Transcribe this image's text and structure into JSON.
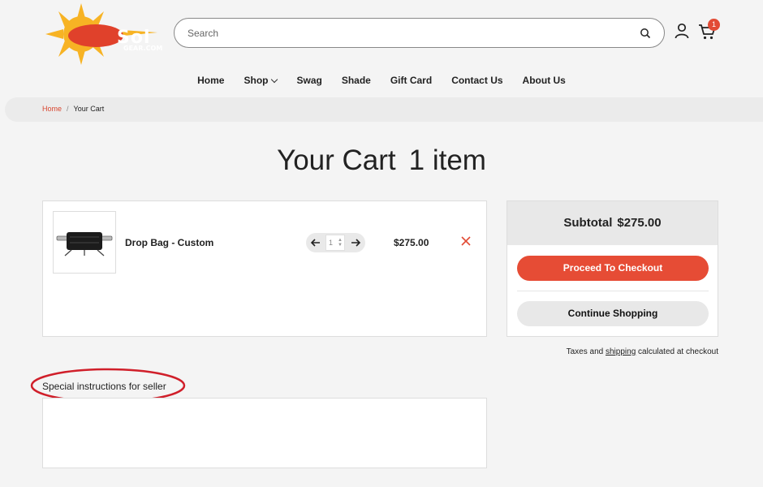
{
  "header": {
    "logo": {
      "text": "Sol",
      "sub": "GEAR.COM"
    },
    "search": {
      "placeholder": "Search"
    },
    "cart_count": "1"
  },
  "nav": {
    "items": [
      {
        "label": "Home"
      },
      {
        "label": "Shop",
        "has_dropdown": true
      },
      {
        "label": "Swag"
      },
      {
        "label": "Shade"
      },
      {
        "label": "Gift Card"
      },
      {
        "label": "Contact Us"
      },
      {
        "label": "About Us"
      }
    ]
  },
  "breadcrumb": {
    "home": "Home",
    "separator": "/",
    "current": "Your Cart"
  },
  "page": {
    "title": "Your Cart",
    "count": "1 item"
  },
  "cart": {
    "items": [
      {
        "name": "Drop Bag - Custom",
        "quantity": "1",
        "price": "$275.00"
      }
    ]
  },
  "summary": {
    "subtotal_label": "Subtotal",
    "subtotal_value": "$275.00",
    "checkout_label": "Proceed To Checkout",
    "continue_label": "Continue Shopping",
    "taxes_prefix": "Taxes and",
    "taxes_link": "shipping",
    "taxes_suffix": "calculated at checkout"
  },
  "instructions": {
    "label": "Special instructions for seller",
    "value": ""
  },
  "colors": {
    "accent": "#e64c35",
    "annotation": "#d01f2a",
    "logo_sun": "#f7b324",
    "logo_red": "#e0412b"
  }
}
